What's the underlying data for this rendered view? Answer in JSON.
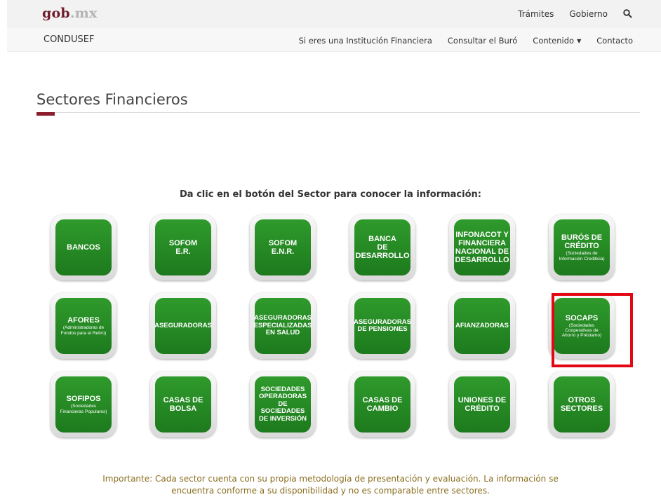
{
  "header": {
    "logo_main": "gob",
    "logo_tld": ".mx",
    "links": [
      "Trámites",
      "Gobierno"
    ]
  },
  "subheader": {
    "brand": "CONDUSEF",
    "nav": [
      "Si eres una Institución Financiera",
      "Consultar el Buró",
      "Contenido",
      "Contacto"
    ]
  },
  "page": {
    "title": "Sectores Financieros",
    "instruction": "Da clic en el botón del Sector para conocer la información:",
    "note_line1": "Importante: Cada sector cuenta con su propia metodología de presentación y evaluación. La información se",
    "note_line2": "encuentra conforme a su disponibilidad y no es comparable entre sectores."
  },
  "colors": {
    "button_green": "#2a8f28",
    "accent": "#8b1d2c",
    "highlight": "#e30613"
  },
  "sectors": [
    {
      "label": "BANCOS",
      "sub": ""
    },
    {
      "label": "SOFOM\nE.R.",
      "sub": ""
    },
    {
      "label": "SOFOM\nE.N.R.",
      "sub": ""
    },
    {
      "label": "BANCA\nDE\nDESARROLLO",
      "sub": ""
    },
    {
      "label": "INFONACOT Y\nFINANCIERA\nNACIONAL DE\nDESARROLLO",
      "sub": ""
    },
    {
      "label": "BURÓS DE\nCRÉDITO",
      "sub": "(Sociedades de\nInformación Crediticia)"
    },
    {
      "label": "AFORES",
      "sub": "(Administradoras de\nFondos para el Retiro)"
    },
    {
      "label": "ASEGURADORAS",
      "sub": ""
    },
    {
      "label": "ASEGURADORAS\nESPECIALIZADAS\nEN SALUD",
      "sub": ""
    },
    {
      "label": "ASEGURADORAS\nDE PENSIONES",
      "sub": ""
    },
    {
      "label": "AFIANZADORAS",
      "sub": ""
    },
    {
      "label": "SOCAPS",
      "sub": "(Sociedades\nCooperativas de\nAhorro y Préstamo)"
    },
    {
      "label": "SOFIPOS",
      "sub": "(Sociedades\nFinancieras Populares)"
    },
    {
      "label": "CASAS DE\nBOLSA",
      "sub": ""
    },
    {
      "label": "SOCIEDADES\nOPERADORAS\nDE\nSOCIEDADES\nDE INVERSIÓN",
      "sub": ""
    },
    {
      "label": "CASAS DE\nCAMBIO",
      "sub": ""
    },
    {
      "label": "UNIONES DE\nCRÉDITO",
      "sub": ""
    },
    {
      "label": "OTROS\nSECTORES",
      "sub": ""
    }
  ]
}
